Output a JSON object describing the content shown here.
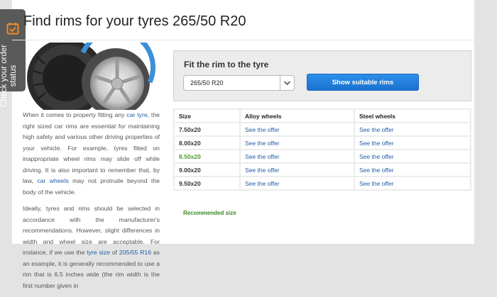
{
  "side_tab": {
    "label": "Check your order status",
    "icon": "order-status-calendar-icon",
    "color": "#5a5a5a",
    "accent": "#f08a24"
  },
  "page": {
    "title": "Find rims for your tyres 265/50 R20"
  },
  "fit": {
    "heading": "Fit the rim to the tyre",
    "selected_size": "265/50 R20",
    "show_button_label": "Show suitable rims"
  },
  "description": {
    "p1": {
      "t1": "When it comes to property fitting any ",
      "link1": "car tyre",
      "t2": ", the right sized car rims are essential for maintaining high safety and various other driving properties of your vehicle. For example, tyres fitted on inappropriate wheel rims may slide off while driving. It is also important to remember that, by law, ",
      "link2": "car wheels",
      "t3": " may not protrude beyond the body of the vehicle."
    },
    "p2": {
      "t1": "Ideally, tyres and rims should be selected in accordance with the manufacturer's recommendations. However, slight differences in width and wheel size are acceptable. For instance, if we use the ",
      "link1": "tyre size",
      "t2": " of ",
      "link2": "205/55 R16",
      "t3": " as an example, it is generally recommended to use a rim that is 6.5 inches wide  (the rim width is the first number given in"
    }
  },
  "table": {
    "headers": {
      "size": "Size",
      "alloy": "Alloy wheels",
      "steel": "Steel wheels"
    },
    "rows": [
      {
        "size": "7.50x20",
        "alloy": "See the offer",
        "steel": "See the offer",
        "recommended": false
      },
      {
        "size": "8.00x20",
        "alloy": "See the offer",
        "steel": "See the offer",
        "recommended": false
      },
      {
        "size": "8.50x20",
        "alloy": "See the offer",
        "steel": "See the offer",
        "recommended": true
      },
      {
        "size": "9.00x20",
        "alloy": "See the offer",
        "steel": "See the offer",
        "recommended": false
      },
      {
        "size": "9.50x20",
        "alloy": "See the offer",
        "steel": "See the offer",
        "recommended": false
      }
    ]
  },
  "recommended_label": "Recommended size",
  "colors": {
    "link": "#1f5ca8",
    "recommended": "#4a9a2c",
    "button": "#1a72cf"
  }
}
